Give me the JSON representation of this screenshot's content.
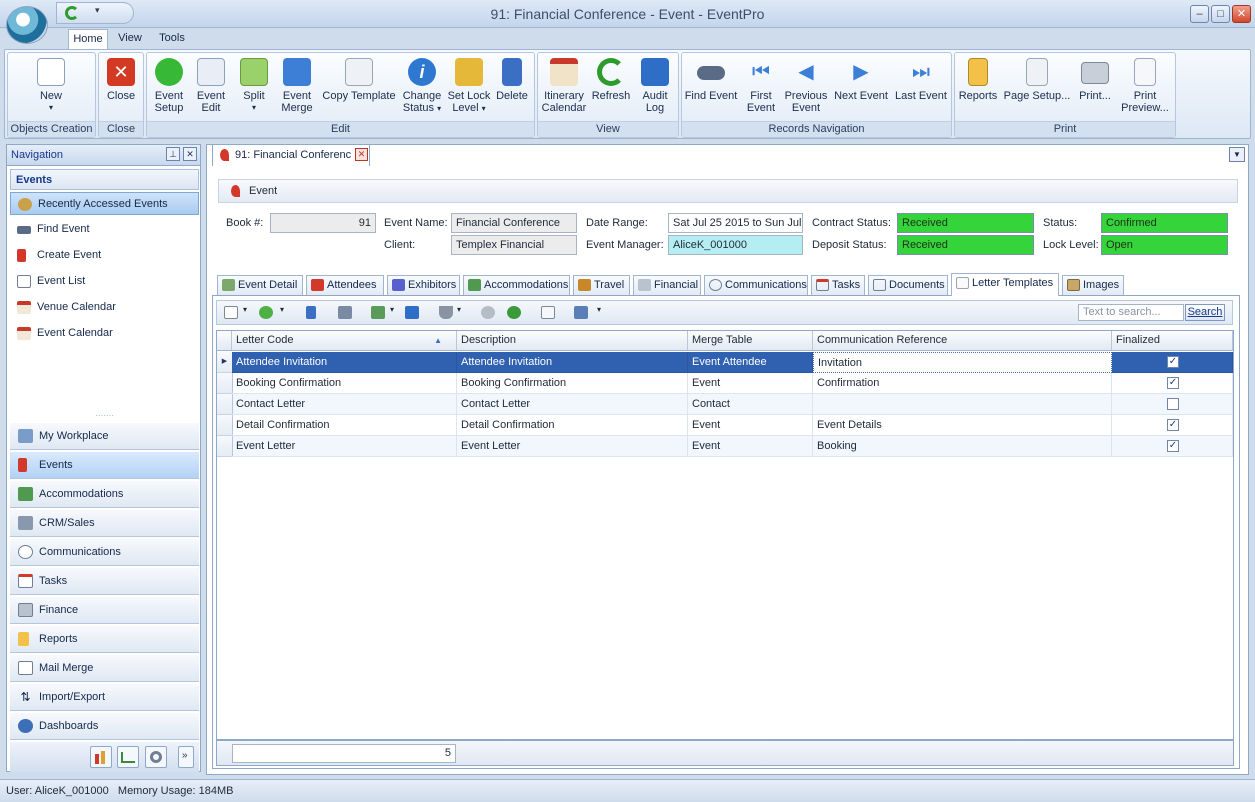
{
  "window": {
    "title": "91: Financial Conference - Event - EventPro"
  },
  "menu_tabs": [
    "Home",
    "View",
    "Tools"
  ],
  "ribbon": {
    "groups": {
      "objects_creation": "Objects Creation",
      "close": "Close",
      "edit": "Edit",
      "view": "View",
      "records_navigation": "Records Navigation",
      "print": "Print"
    },
    "buttons": {
      "new": "New",
      "close": "Close",
      "event_setup": [
        "Event",
        "Setup"
      ],
      "event_edit": [
        "Event",
        "Edit"
      ],
      "split": "Split",
      "event_merge": [
        "Event",
        "Merge"
      ],
      "copy_template": "Copy Template",
      "change_status": [
        "Change",
        "Status"
      ],
      "set_lock_level": [
        "Set Lock",
        "Level"
      ],
      "delete": "Delete",
      "itinerary_calendar": [
        "Itinerary",
        "Calendar"
      ],
      "refresh": "Refresh",
      "audit_log": [
        "Audit",
        "Log"
      ],
      "find_event": "Find Event",
      "first_event": [
        "First",
        "Event"
      ],
      "previous_event": [
        "Previous",
        "Event"
      ],
      "next_event": "Next Event",
      "last_event": "Last Event",
      "reports": "Reports",
      "page_setup": "Page Setup...",
      "print": "Print...",
      "print_preview": [
        "Print",
        "Preview..."
      ]
    }
  },
  "navigation": {
    "title": "Navigation",
    "section": "Events",
    "items": [
      "Recently Accessed Events",
      "Find Event",
      "Create Event",
      "Event List",
      "Venue Calendar",
      "Event Calendar"
    ],
    "modules": [
      "My Workplace",
      "Events",
      "Accommodations",
      "CRM/Sales",
      "Communications",
      "Tasks",
      "Finance",
      "Reports",
      "Mail Merge",
      "Import/Export",
      "Dashboards"
    ]
  },
  "document_tab": "91: Financial Conferenc",
  "event": {
    "header": "Event",
    "book_label": "Book #:",
    "book_value": "91",
    "name_label": "Event Name:",
    "name_value": "Financial Conference",
    "client_label": "Client:",
    "client_value": "Templex Financial",
    "date_range_label": "Date Range:",
    "date_range_value": "Sat Jul 25 2015 to Sun Jul",
    "manager_label": "Event Manager:",
    "manager_value": "AliceK_001000",
    "contract_status_label": "Contract Status:",
    "contract_status_value": "Received",
    "deposit_status_label": "Deposit Status:",
    "deposit_status_value": "Received",
    "status_label": "Status:",
    "status_value": "Confirmed",
    "lock_level_label": "Lock Level:",
    "lock_level_value": "Open"
  },
  "sub_tabs": [
    "Event Detail",
    "Attendees",
    "Exhibitors",
    "Accommodations",
    "Travel",
    "Financial",
    "Communications",
    "Tasks",
    "Documents",
    "Letter Templates",
    "Images"
  ],
  "search": {
    "placeholder": "Text to search...",
    "button": "Search"
  },
  "grid": {
    "columns": [
      "Letter Code",
      "Description",
      "Merge Table",
      "Communication Reference",
      "Finalized"
    ],
    "rows": [
      {
        "code": "Attendee Invitation",
        "description": "Attendee Invitation",
        "merge_table": "Event Attendee",
        "reference": "Invitation",
        "finalized": true
      },
      {
        "code": "Booking Confirmation",
        "description": "Booking Confirmation",
        "merge_table": "Event",
        "reference": "Confirmation",
        "finalized": true
      },
      {
        "code": "Contact Letter",
        "description": "Contact Letter",
        "merge_table": "Contact",
        "reference": "",
        "finalized": false
      },
      {
        "code": "Detail Confirmation",
        "description": "Detail Confirmation",
        "merge_table": "Event",
        "reference": "Event Details",
        "finalized": true
      },
      {
        "code": "Event Letter",
        "description": "Event Letter",
        "merge_table": "Event",
        "reference": "Booking",
        "finalized": true
      }
    ],
    "count": "5"
  },
  "status_bar": {
    "text": "User: AliceK_001000   Memory Usage: 184MB"
  },
  "colors": {
    "accent": "#3060b0",
    "status_green": "#35d43a",
    "manager_field": "#b5eef2"
  }
}
